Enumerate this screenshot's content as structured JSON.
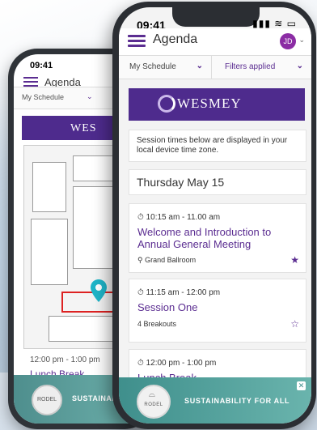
{
  "back_phone": {
    "status_time": "09:41",
    "title": "Agenda",
    "tab": "My Schedule",
    "banner_logo": "WES",
    "session_time": "12:00 pm - 1:00 pm",
    "session_title": "Lunch Break",
    "footer_brand": "RODEL",
    "footer_text": "SUSTAINAB"
  },
  "status": {
    "time": "09:41",
    "icons": "▮▮▮ ≋ ▭"
  },
  "header": {
    "title": "Agenda",
    "avatar": "JD",
    "avatar_chevron": "⌄"
  },
  "filters": {
    "schedule_label": "My Schedule",
    "filters_label": "Filters applied",
    "chevron": "⌄"
  },
  "banner": {
    "logo_text": "WESMEY",
    "color": "#4e2b8d"
  },
  "notice": "Session times below are displayed in your local device time zone.",
  "date_header": "Thursday May 15",
  "sessions": [
    {
      "time": "⏱ 10:15 am - 11.00 am",
      "title": "Welcome and Introduction to Annual General Meeting",
      "location": "⚲ Grand Ballroom",
      "star": "★"
    },
    {
      "time": "⏱ 11:15 am - 12:00 pm",
      "title": "Session One",
      "breakouts": "4 Breakouts",
      "star": "☆"
    },
    {
      "time": "⏱ 12:00 pm - 1:00 pm",
      "title": "Lunch Break"
    }
  ],
  "footer": {
    "brand": "RODEL",
    "tagline": "SUSTAINABILITY FOR ALL",
    "close": "✕"
  },
  "colors": {
    "accent": "#5b2d91",
    "footer": "#4f9e99"
  }
}
